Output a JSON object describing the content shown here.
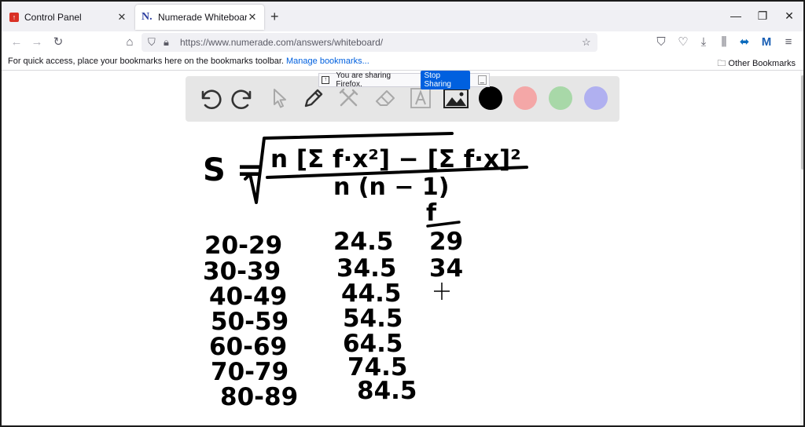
{
  "browser": {
    "tabs": [
      {
        "label": "Control Panel",
        "active": false,
        "favicon": "control-panel-favicon"
      },
      {
        "label": "Numerade Whiteboard",
        "active": true,
        "favicon": "numerade-favicon"
      }
    ],
    "url": "https://www.numerade.com/answers/whiteboard/",
    "bookmarks_hint": "For quick access, place your bookmarks here on the bookmarks toolbar.",
    "bookmarks_link": "Manage bookmarks...",
    "other_bookmarks": "Other Bookmarks"
  },
  "sharing_bar": {
    "message": "You are sharing Firefox.",
    "stop_label": "Stop Sharing"
  },
  "whiteboard": {
    "tools": [
      "undo-icon",
      "redo-icon",
      "select-pointer-icon",
      "pen-icon",
      "tools-icon",
      "eraser-icon",
      "text-icon",
      "image-icon"
    ],
    "colors": [
      "#000000",
      "#f4a7a7",
      "#a8d8a8",
      "#b0b0f0"
    ]
  },
  "handwriting": {
    "formula_lhs": "S =",
    "numerator": "n [Σ f·x²] − [Σ f·x]²",
    "denominator": "n (n − 1)",
    "column_f": "f",
    "classes": [
      "20-29",
      "30-39",
      "40-49",
      "50-59",
      "60-69",
      "70-79",
      "80-89"
    ],
    "midpoints": [
      "24.5",
      "34.5",
      "44.5",
      "54.5",
      "64.5",
      "74.5",
      "84.5"
    ],
    "frequencies": [
      "29",
      "34"
    ]
  }
}
